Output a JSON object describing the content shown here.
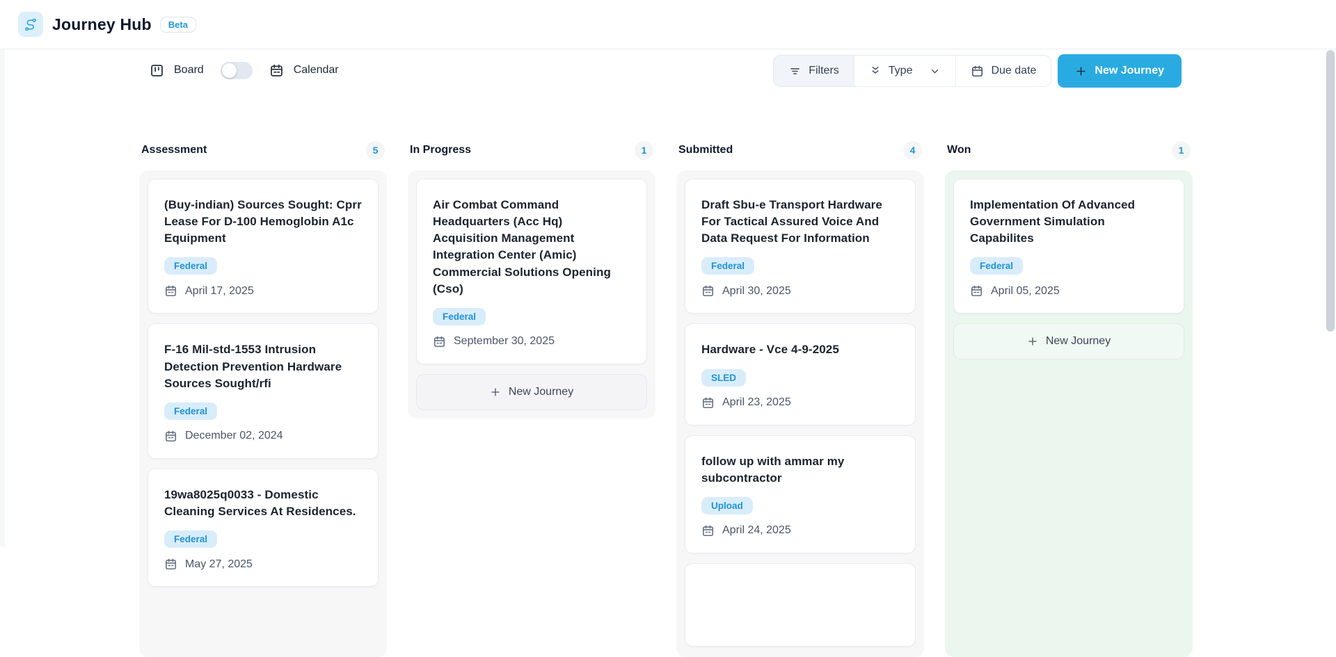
{
  "header": {
    "app_title": "Journey Hub",
    "beta_badge": "Beta"
  },
  "toolbar": {
    "board_label": "Board",
    "calendar_label": "Calendar",
    "filters_label": "Filters",
    "type_label": "Type",
    "due_date_label": "Due date",
    "new_journey_label": "New Journey"
  },
  "board": {
    "new_journey_label": "New Journey"
  },
  "colors": {
    "accent_blue": "#29abe2",
    "badge_bg": "#d9ecfa",
    "badge_text": "#1e93d6",
    "count_text": "#2196d9",
    "column_bg_gray": "#f7f7f8",
    "column_bg_green": "#ebf6ef"
  },
  "columns": [
    {
      "name": "Assessment",
      "count": "5",
      "tone": "gray",
      "full_height": true,
      "new_journey": false,
      "cards": [
        {
          "title": "(Buy-indian) Sources Sought: Cprr Lease For D-100 Hemoglobin A1c Equipment",
          "badge": "Federal",
          "date": "April 17, 2025"
        },
        {
          "title": "F-16 Mil-std-1553 Intrusion Detection Prevention Hardware Sources Sought/rfi",
          "badge": "Federal",
          "date": "December 02, 2024"
        },
        {
          "title": "19wa8025q0033 - Domestic Cleaning Services At Residences.",
          "badge": "Federal",
          "date": "May 27, 2025"
        }
      ]
    },
    {
      "name": "In Progress",
      "count": "1",
      "tone": "gray",
      "full_height": false,
      "new_journey": true,
      "cards": [
        {
          "title": "Air Combat Command Headquarters (Acc Hq) Acquisition Management Integration Center (Amic) Commercial Solutions Opening (Cso)",
          "badge": "Federal",
          "date": "September 30, 2025"
        }
      ]
    },
    {
      "name": "Submitted",
      "count": "4",
      "tone": "gray",
      "full_height": true,
      "new_journey": false,
      "cards": [
        {
          "title": "Draft Sbu-e Transport Hardware For Tactical Assured Voice And Data Request For Information",
          "badge": "Federal",
          "date": "April 30, 2025"
        },
        {
          "title": "Hardware - Vce 4-9-2025",
          "badge": "SLED",
          "date": "April 23, 2025"
        },
        {
          "title": "follow up with ammar my subcontractor",
          "badge": "Upload",
          "date": "April 24, 2025"
        },
        {
          "title": "",
          "badge": "",
          "date": "",
          "partial": true
        }
      ]
    },
    {
      "name": "Won",
      "count": "1",
      "tone": "green",
      "full_height": true,
      "new_journey": true,
      "cards": [
        {
          "title": "Implementation Of Advanced Government Simulation Capabilites",
          "badge": "Federal",
          "date": "April 05, 2025"
        }
      ]
    }
  ]
}
